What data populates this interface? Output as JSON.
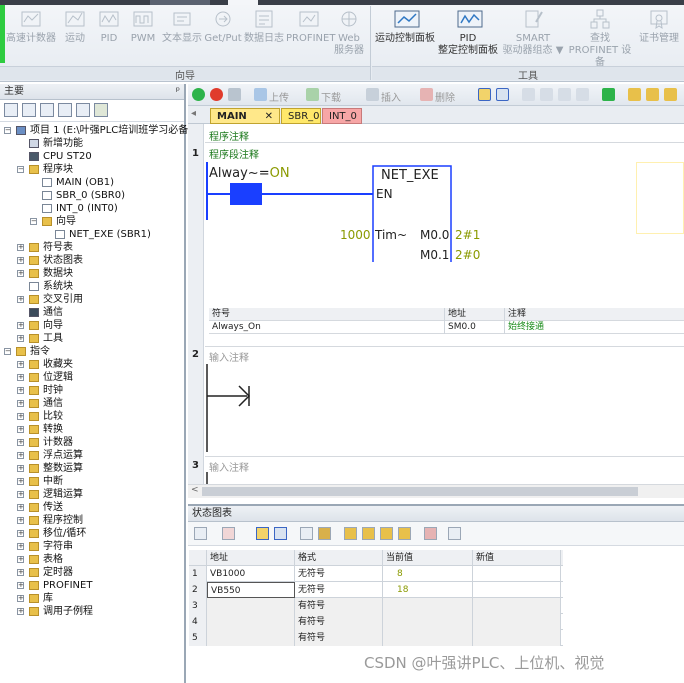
{
  "ribbon": {
    "buttons_left": [
      {
        "label": "高速计数器",
        "icon": "counter-icon"
      },
      {
        "label": "运动",
        "icon": "motion-icon"
      },
      {
        "label": "PID",
        "icon": "pid-icon"
      },
      {
        "label": "PWM",
        "icon": "pwm-icon"
      },
      {
        "label": "文本显示",
        "icon": "text-display-icon"
      },
      {
        "label": "Get/Put",
        "icon": "getput-icon"
      },
      {
        "label": "数据日志",
        "icon": "datalog-icon"
      },
      {
        "label": "PROFINET",
        "icon": "profinet-icon"
      },
      {
        "label": "Web 服务器",
        "line1": "Web",
        "line2": "服务器",
        "icon": "web-server-icon"
      }
    ],
    "group_left": "向导",
    "buttons_right": [
      {
        "label": "运动控制面板",
        "icon": "motion-panel-icon"
      },
      {
        "label": "PID 整定控制面板",
        "line1": "PID",
        "line2": "整定控制面板",
        "icon": "pid-tuning-icon"
      },
      {
        "label": "SMART 驱动器组态",
        "line1": "SMART",
        "line2": "驱动器组态 ▼",
        "icon": "smart-drive-icon"
      },
      {
        "label": "查找 PROFINET 设备",
        "line1": "查找",
        "line2": "PROFINET 设备",
        "icon": "find-device-icon"
      },
      {
        "label": "证书管理",
        "icon": "certificate-icon"
      }
    ],
    "group_right": "工具"
  },
  "left_pane": {
    "title": "主要",
    "pin": "ᵖ",
    "tree": [
      {
        "label": "项目 1 (E:\\叶强PLC培训班学习必备资",
        "level": 0,
        "exp": "−",
        "icon": "project"
      },
      {
        "label": "新增功能",
        "level": 1,
        "icon": "new"
      },
      {
        "label": "CPU ST20",
        "level": 1,
        "icon": "cpu"
      },
      {
        "label": "程序块",
        "level": 1,
        "exp": "−",
        "icon": "folder"
      },
      {
        "label": "MAIN (OB1)",
        "level": 2,
        "icon": "doc"
      },
      {
        "label": "SBR_0 (SBR0)",
        "level": 2,
        "icon": "doc"
      },
      {
        "label": "INT_0 (INT0)",
        "level": 2,
        "icon": "doc"
      },
      {
        "label": "向导",
        "level": 2,
        "exp": "−",
        "icon": "folder"
      },
      {
        "label": "NET_EXE (SBR1)",
        "level": 3,
        "icon": "doc"
      },
      {
        "label": "符号表",
        "level": 1,
        "exp": "+",
        "icon": "folder"
      },
      {
        "label": "状态图表",
        "level": 1,
        "exp": "+",
        "icon": "folder"
      },
      {
        "label": "数据块",
        "level": 1,
        "exp": "+",
        "icon": "folder"
      },
      {
        "label": "系统块",
        "level": 1,
        "icon": "doc"
      },
      {
        "label": "交叉引用",
        "level": 1,
        "exp": "+",
        "icon": "folder"
      },
      {
        "label": "通信",
        "level": 1,
        "icon": "comm"
      },
      {
        "label": "向导",
        "level": 1,
        "exp": "+",
        "icon": "folder"
      },
      {
        "label": "工具",
        "level": 1,
        "exp": "+",
        "icon": "folder"
      },
      {
        "label": "指令",
        "level": 0,
        "exp": "−",
        "icon": "folder"
      },
      {
        "label": "收藏夹",
        "level": 1,
        "exp": "+",
        "icon": "folder"
      },
      {
        "label": "位逻辑",
        "level": 1,
        "exp": "+",
        "icon": "folder"
      },
      {
        "label": "时钟",
        "level": 1,
        "exp": "+",
        "icon": "folder"
      },
      {
        "label": "通信",
        "level": 1,
        "exp": "+",
        "icon": "folder"
      },
      {
        "label": "比较",
        "level": 1,
        "exp": "+",
        "icon": "folder"
      },
      {
        "label": "转换",
        "level": 1,
        "exp": "+",
        "icon": "folder"
      },
      {
        "label": "计数器",
        "level": 1,
        "exp": "+",
        "icon": "folder"
      },
      {
        "label": "浮点运算",
        "level": 1,
        "exp": "+",
        "icon": "folder"
      },
      {
        "label": "整数运算",
        "level": 1,
        "exp": "+",
        "icon": "folder"
      },
      {
        "label": "中断",
        "level": 1,
        "exp": "+",
        "icon": "folder"
      },
      {
        "label": "逻辑运算",
        "level": 1,
        "exp": "+",
        "icon": "folder"
      },
      {
        "label": "传送",
        "level": 1,
        "exp": "+",
        "icon": "folder"
      },
      {
        "label": "程序控制",
        "level": 1,
        "exp": "+",
        "icon": "folder"
      },
      {
        "label": "移位/循环",
        "level": 1,
        "exp": "+",
        "icon": "folder"
      },
      {
        "label": "字符串",
        "level": 1,
        "exp": "+",
        "icon": "folder"
      },
      {
        "label": "表格",
        "level": 1,
        "exp": "+",
        "icon": "folder"
      },
      {
        "label": "定时器",
        "level": 1,
        "exp": "+",
        "icon": "folder"
      },
      {
        "label": "PROFINET",
        "level": 1,
        "exp": "+",
        "icon": "folder"
      },
      {
        "label": "库",
        "level": 1,
        "exp": "+",
        "icon": "folder"
      },
      {
        "label": "调用子例程",
        "level": 1,
        "exp": "+",
        "icon": "folder"
      }
    ]
  },
  "editor": {
    "toolbar": {
      "upload": "上传",
      "download": "下载",
      "insert": "插入",
      "delete": "删除"
    },
    "tabs": [
      {
        "label": "MAIN",
        "close": "✕"
      },
      {
        "label": "SBR_0"
      },
      {
        "label": "INT_0"
      }
    ],
    "program_comment": "程序注释",
    "networks": [
      {
        "no": "1",
        "comment": "程序段注释"
      },
      {
        "no": "2",
        "comment": "输入注释"
      },
      {
        "no": "3",
        "comment": "输入注释"
      }
    ],
    "contact": {
      "name": "Alway~",
      "eq": "=",
      "value": "ON"
    },
    "block": {
      "title": "NET_EXE",
      "en": "EN",
      "param": "Tim~",
      "param_value": "1000",
      "out1": "M0.0",
      "out1_val": "2#1",
      "out2": "M0.1",
      "out2_val": "2#0"
    },
    "symbols": {
      "headers": [
        "符号",
        "地址",
        "注释"
      ],
      "rows": [
        [
          "Always_On",
          "SM0.0",
          "始终接通"
        ]
      ]
    }
  },
  "status_chart": {
    "title": "状态图表",
    "headers": [
      "",
      "地址",
      "格式",
      "当前值",
      "新值"
    ],
    "rows": [
      [
        "1",
        "VB1000",
        "无符号",
        "8",
        ""
      ],
      [
        "2",
        "VB550",
        "无符号",
        "18",
        ""
      ],
      [
        "3",
        "",
        "有符号",
        "",
        ""
      ],
      [
        "4",
        "",
        "有符号",
        "",
        ""
      ],
      [
        "5",
        "",
        "有符号",
        "",
        ""
      ]
    ]
  },
  "watermark": "CSDN @叶强讲PLC、上位机、视觉",
  "colors": {
    "accent": "#1a3fff",
    "green_value": "#8a9a00",
    "active_tab": "#ffe88a",
    "ladder_green": "#1c8c1c"
  }
}
